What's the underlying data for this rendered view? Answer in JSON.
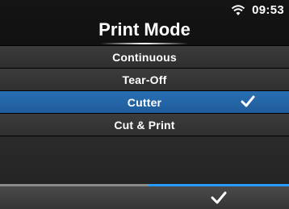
{
  "status": {
    "time": "09:53",
    "icons": [
      "wifi-icon"
    ]
  },
  "title": "Print Mode",
  "menu": {
    "items": [
      {
        "label": "Continuous",
        "selected": false,
        "checked": false
      },
      {
        "label": "Tear-Off",
        "selected": false,
        "checked": false
      },
      {
        "label": "Cutter",
        "selected": true,
        "checked": true
      },
      {
        "label": "Cut & Print",
        "selected": false,
        "checked": false
      }
    ]
  },
  "footer": {
    "left_button": "",
    "right_button_icon": "checkmark-icon"
  },
  "colors": {
    "accent": "#2a9cff",
    "selected": "#2366a8",
    "item": "#363636"
  }
}
